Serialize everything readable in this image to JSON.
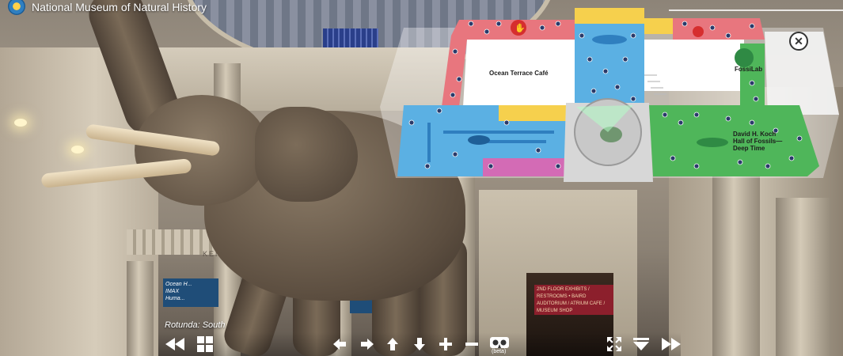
{
  "header": {
    "title": "National Museum of Natural History"
  },
  "map": {
    "labels": {
      "ocean_cafe": "Ocean Terrace Café",
      "fossilab": "FossiLab",
      "hall_of_fossils": "David H. Koch\nHall of Fossils—\nDeep Time"
    },
    "colors": {
      "pink": "#e8767e",
      "blue": "#5bb0e3",
      "green": "#4fb65a",
      "yellow": "#f6d04d",
      "magenta": "#d36bb5",
      "gray": "#d7d7d7",
      "white": "#ffffff"
    }
  },
  "scene": {
    "location": "Rotunda: South",
    "banner_text": "Ocean H...\nIMAX\nHuma...",
    "sign_text": "2ND FLOOR EXHIBITS / RESTROOMS  •  BAIRD AUDITORIUM / ATRIUM CAFE / MUSEUM SHOP",
    "kennedy_text": "KENNE"
  },
  "toolbar": {
    "beta_label": "(beta)"
  }
}
